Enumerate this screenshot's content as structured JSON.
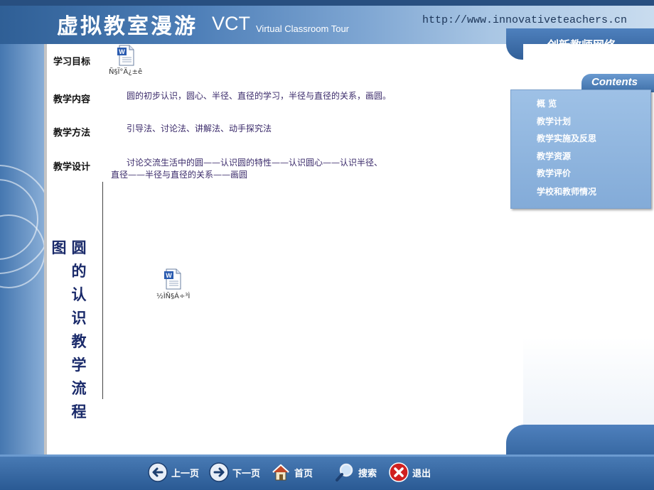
{
  "header": {
    "title_cn": "虚拟教室漫游",
    "title_abbr": "VCT",
    "title_en": "Virtual Classroom Tour",
    "url": "http://www.innovativeteachers.cn",
    "org_name": "创新教师网络"
  },
  "contents": {
    "label": "Contents",
    "items": [
      "概  览",
      "教学计划",
      "教学实施及反思",
      "教学资源",
      "教学评价",
      "学校和教师情况"
    ]
  },
  "main": {
    "goal": {
      "label": "学习目标",
      "attachment_caption": "Ñ§Ï°Ä¿±ê"
    },
    "content": {
      "label": "教学内容",
      "text": "圆的初步认识，圆心、半径、直径的学习，半径与直径的关系，画圆。"
    },
    "method": {
      "label": "教学方法",
      "text": "引导法、讨论法、讲解法、动手探究法"
    },
    "design": {
      "label": "教学设计",
      "line1": "讨论交流生活中的圆——认识圆的特性——认识圆心——认识半径、",
      "line2": "直径——半径与直径的关系——画圆"
    },
    "diagram_label_left": "图",
    "diagram_label_right": [
      "圆",
      "的",
      "认",
      "识",
      "教",
      "学",
      "流",
      "程"
    ],
    "attachment2_caption": "½ÌÑ§Á÷³Ì"
  },
  "nav": {
    "prev": "上一页",
    "next": "下一页",
    "home": "首页",
    "search": "搜索",
    "exit": "退出"
  },
  "icons": {
    "prev": "arrow-left-icon",
    "next": "arrow-right-icon",
    "home": "house-icon",
    "search": "magnifier-icon",
    "exit": "close-icon",
    "doc": "word-document-icon"
  },
  "colors": {
    "header_blue": "#2f5f96",
    "panel_blue": "#9ec1e6",
    "text_purple": "#3a2a6a",
    "exit_red": "#d02020"
  }
}
